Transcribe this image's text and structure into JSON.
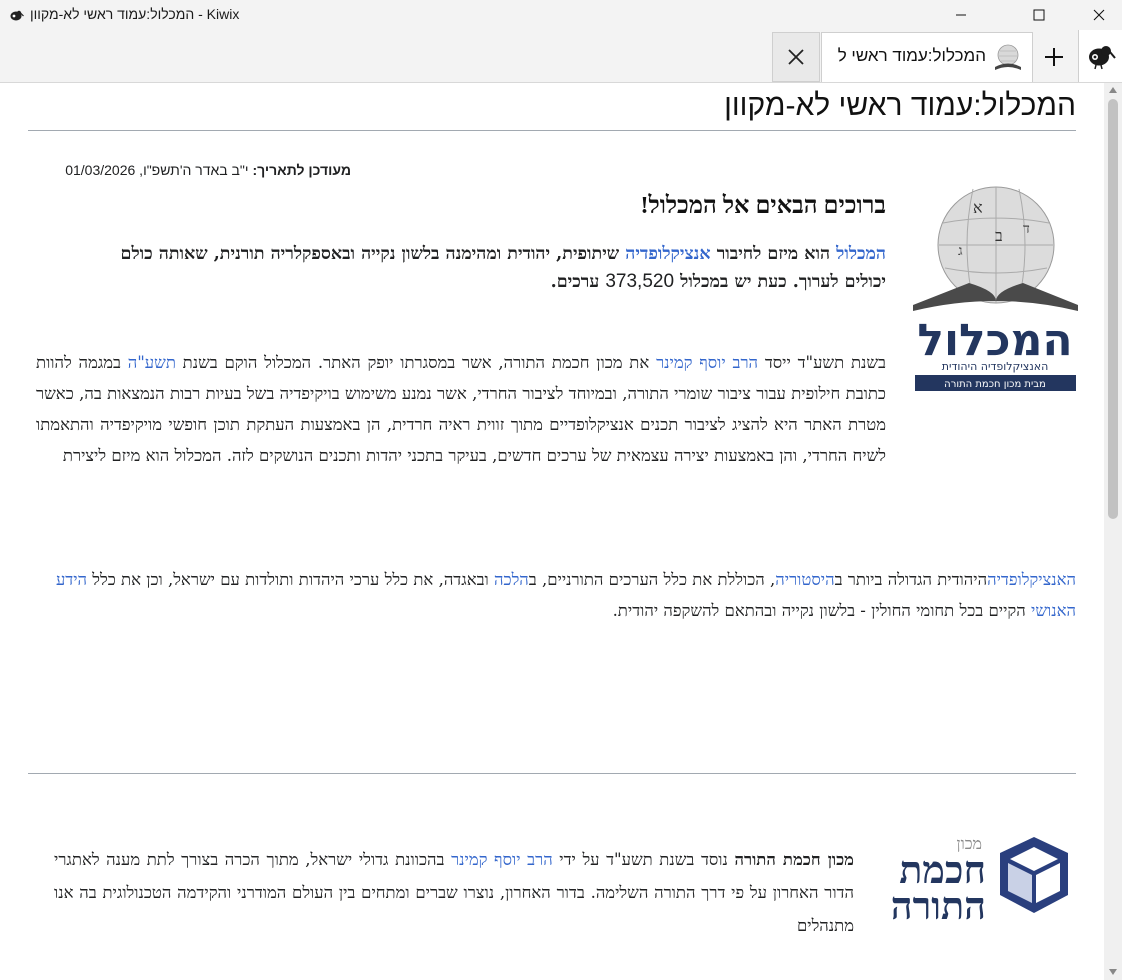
{
  "window": {
    "title": "המכלול:עמוד ראשי לא-מקוון - Kiwix",
    "app_name": "Kiwix"
  },
  "tabs": [
    {
      "label": "המכלול:עמוד ראשי ל",
      "active": true
    }
  ],
  "page": {
    "title": "המכלול:עמוד ראשי לא-מקוון",
    "updated_label": "מעודכן לתאריך:",
    "updated_value": "י\"ב באדר ה'תשפ\"ו, 01/03/2026",
    "welcome_heading": "ברוכים הבאים אל המכלול!",
    "intro": {
      "link_hamichlol": "המכלול",
      "text1": "הוא מיזם לחיבור",
      "link_encyclopedia": "אנציקלופדיה",
      "text2": "שיתופית, יהודית ומהימנה בלשון נקייה ובאספקלריה תורנית, שאותה כולם יכולים לערוך. כעת יש במכלול",
      "article_count": "373,520",
      "text3": "ערכים."
    },
    "para": {
      "t1": "בשנת תשע\"ד ייסד",
      "link_rabbi": "הרב יוסף קמינר",
      "t2": "את מכון חכמת התורה, אשר במסגרתו יופק האתר. המכלול הוקם בשנת",
      "link_year": "תשע\"ה",
      "t3": "במגמה להוות כתובת חילופית עבור ציבור שומרי התורה, ובמיוחד לציבור החרדי, אשר נמנע משימוש בויקיפדיה בשל בעיות רבות הנמצאות בה, כאשר מטרת האתר היא להציג לציבור תכנים אנציקלופדיים מתוך זווית ראיה חרדית, הן באמצעות העתקת תוכן חופשי מויקיפדיה והתאמתו לשיח החרדי, והן באמצעות יצירה עצמאית של ערכים חדשים, בעיקר בתכני יהדות ותכנים הנושקים לזה. המכלול הוא מיזם ליצירת",
      "link_encyclopedia": "האנציקלופדיה",
      "t4": "היהודית הגדולה ביותר ב",
      "link_history": "היסטוריה",
      "t5": ", הכוללת את כלל הערכים התורניים, ב",
      "link_halacha": "הלכה",
      "t6": "ובאגדה, את כלל ערכי היהדות ותולדות עם ישראל, וכן את כלל",
      "link_knowledge": "הידע האנושי",
      "t7": "הקיים בכל תחומי החולין - בלשון נקייה ובהתאם להשקפה יהודית."
    },
    "institute": {
      "bold_name": "מכון חכמת התורה",
      "t1": "נוסד בשנת תשע\"ד על ידי",
      "link_rabbi": "הרב יוסף קמינר",
      "t2": "בהכוונת גדולי ישראל, מתוך הכרה בצורך לתת מענה לאתגרי הדור האחרון על פי דרך התורה השלימה. בדור האחרון, נוצרו שברים ומתחים בין העולם המודרני והקידמה הטכנולוגית בה אנו מתנהלים"
    },
    "logo1_text": {
      "main": "המכלול",
      "sub": "האנציקלופדיה היהודית",
      "band": "מבית מכון חכמת התורה"
    },
    "logo2_text": {
      "small": "מכון",
      "line1": "חכמת",
      "line2": "התורה"
    }
  },
  "colors": {
    "link": "#3366cc",
    "text": "#202122",
    "logo_navy": "#23365f",
    "logo_blue": "#2a3f7e"
  }
}
